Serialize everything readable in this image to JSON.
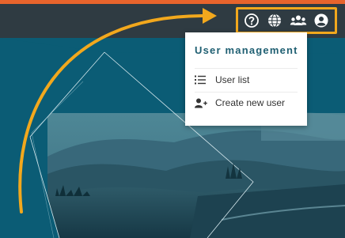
{
  "colors": {
    "accent_bar": "#e8642c",
    "topbar": "#2f3b42",
    "highlight": "#f2a81d",
    "menu_title": "#1f5f72",
    "background": "#0b5c75"
  },
  "toolbar": {
    "icons": [
      "help-icon",
      "globe-icon",
      "users-icon",
      "account-icon"
    ]
  },
  "user_menu": {
    "title": "User management",
    "items": [
      {
        "label": "User list",
        "icon": "list-icon"
      },
      {
        "label": "Create new user",
        "icon": "add-user-icon"
      }
    ]
  }
}
